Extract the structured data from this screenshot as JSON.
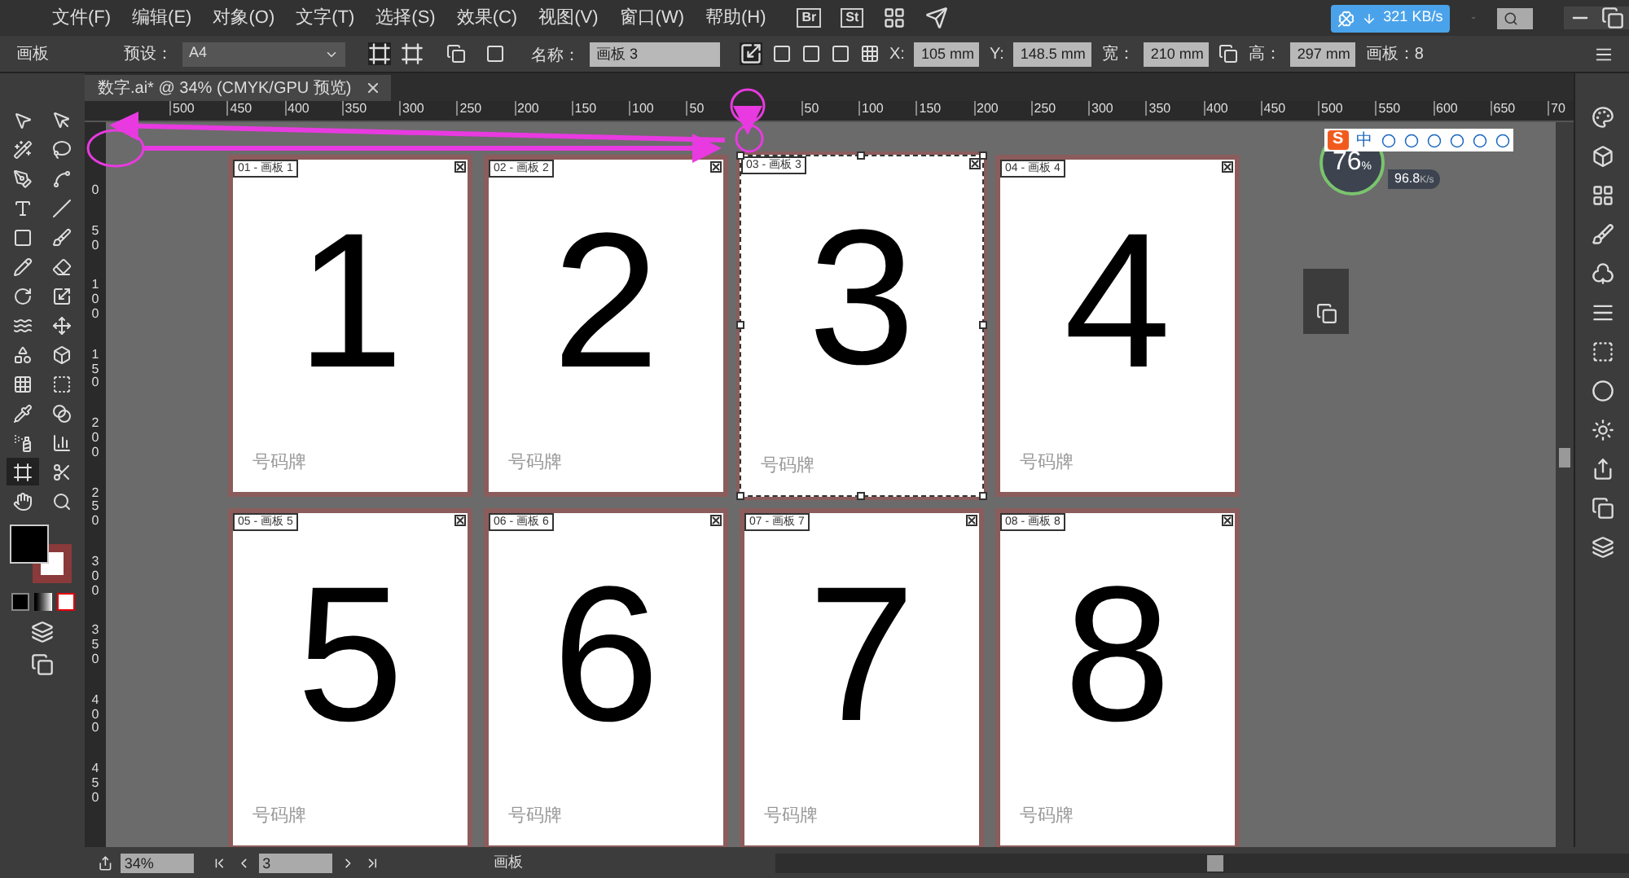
{
  "menu": [
    "文件(F)",
    "编辑(E)",
    "对象(O)",
    "文字(T)",
    "选择(S)",
    "效果(C)",
    "视图(V)",
    "窗口(W)",
    "帮助(H)"
  ],
  "app_buttons": [
    "Br",
    "St"
  ],
  "download": {
    "speed": "321 KB/s"
  },
  "control_bar": {
    "panel": "画板",
    "preset_label": "预设：",
    "preset": "A4",
    "name_label": "名称：",
    "name": "画板 3",
    "x_label": "X:",
    "x": "105 mm",
    "y_label": "Y:",
    "y": "148.5 mm",
    "w_label": "宽：",
    "w": "210 mm",
    "h_label": "高：",
    "h": "297 mm",
    "count": "画板：8"
  },
  "document_tab": {
    "title": "数字.ai* @ 34% (CMYK/GPU 预览)"
  },
  "ruler_h": [
    "500",
    "450",
    "400",
    "350",
    "300",
    "250",
    "200",
    "150",
    "100",
    "50",
    "50",
    "100",
    "150",
    "200",
    "250",
    "300",
    "350",
    "400",
    "450",
    "500",
    "550",
    "600",
    "650",
    "70"
  ],
  "ruler_v": [
    "0",
    "50",
    "100",
    "150",
    "200",
    "250",
    "300",
    "350",
    "400",
    "450"
  ],
  "tools": [
    {
      "kind": "select",
      "selected": false
    },
    {
      "kind": "direct",
      "selected": false
    },
    {
      "kind": "wand",
      "selected": false
    },
    {
      "kind": "lasso",
      "selected": false
    },
    {
      "kind": "pen",
      "selected": false
    },
    {
      "kind": "curvature",
      "selected": false
    },
    {
      "kind": "type",
      "selected": false
    },
    {
      "kind": "line",
      "selected": false
    },
    {
      "kind": "rect",
      "selected": false
    },
    {
      "kind": "brush",
      "selected": false
    },
    {
      "kind": "pencil",
      "selected": false
    },
    {
      "kind": "eraser",
      "selected": false
    },
    {
      "kind": "rotate",
      "selected": false
    },
    {
      "kind": "scale",
      "selected": false
    },
    {
      "kind": "warp",
      "selected": false
    },
    {
      "kind": "transform",
      "selected": false
    },
    {
      "kind": "shape",
      "selected": false
    },
    {
      "kind": "graph3d",
      "selected": false
    },
    {
      "kind": "mesh",
      "selected": false
    },
    {
      "kind": "gradient",
      "selected": false
    },
    {
      "kind": "eyedrop",
      "selected": false
    },
    {
      "kind": "blend",
      "selected": false
    },
    {
      "kind": "symbol",
      "selected": false
    },
    {
      "kind": "chart",
      "selected": false
    },
    {
      "kind": "artboard",
      "selected": true
    },
    {
      "kind": "slice",
      "selected": false
    },
    {
      "kind": "hand",
      "selected": false
    },
    {
      "kind": "zoom",
      "selected": false
    }
  ],
  "artboards": [
    {
      "label": "01 - 画板 1",
      "number": "1",
      "caption": "号码牌",
      "selected": false
    },
    {
      "label": "02 - 画板 2",
      "number": "2",
      "caption": "号码牌",
      "selected": false
    },
    {
      "label": "03 - 画板 3",
      "number": "3",
      "caption": "号码牌",
      "selected": true
    },
    {
      "label": "04 - 画板 4",
      "number": "4",
      "caption": "号码牌",
      "selected": false
    },
    {
      "label": "05 - 画板 5",
      "number": "5",
      "caption": "号码牌",
      "selected": false
    },
    {
      "label": "06 - 画板 6",
      "number": "6",
      "caption": "号码牌",
      "selected": false
    },
    {
      "label": "07 - 画板 7",
      "number": "7",
      "caption": "号码牌",
      "selected": false
    },
    {
      "label": "08 - 画板 8",
      "number": "8",
      "caption": "号码牌",
      "selected": false
    }
  ],
  "speed_widget": {
    "percent": "76",
    "unit": "%",
    "rate": "96.8",
    "rate_unit": "K/s"
  },
  "ime_bar": {
    "logo": "S",
    "mode": "中"
  },
  "status_bar": {
    "zoom": "34%",
    "page": "3",
    "label": "画板"
  }
}
